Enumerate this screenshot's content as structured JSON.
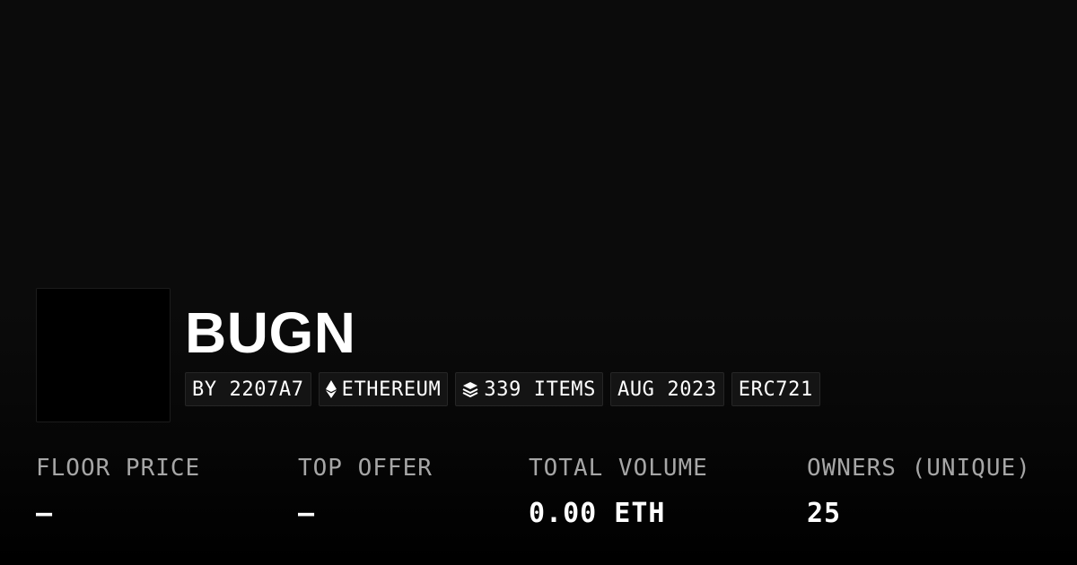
{
  "collection": {
    "name": "BUGN",
    "badges": {
      "creator": "BY 2207A7",
      "chain": "ETHEREUM",
      "items": "339 ITEMS",
      "date": "AUG 2023",
      "standard": "ERC721"
    }
  },
  "stats": {
    "floor_price": {
      "label": "FLOOR PRICE",
      "value": "—"
    },
    "top_offer": {
      "label": "TOP OFFER",
      "value": "—"
    },
    "total_volume": {
      "label": "TOTAL VOLUME",
      "value": "0.00 ETH"
    },
    "owners": {
      "label": "OWNERS (UNIQUE)",
      "value": "25"
    }
  },
  "icons": {
    "chain": "ethereum-icon",
    "items": "layers-icon"
  },
  "colors": {
    "background": "#0b0b0b",
    "badge_background": "#141414",
    "label": "#a6a6a6",
    "text": "#ffffff"
  }
}
